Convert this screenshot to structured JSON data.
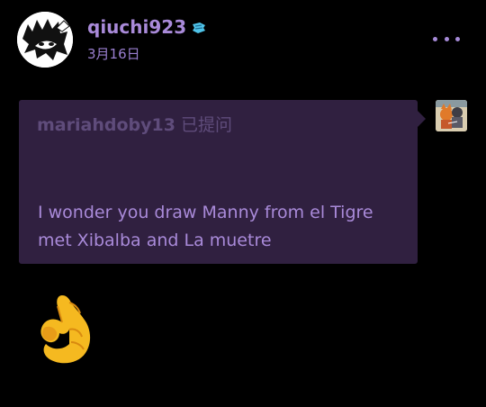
{
  "post": {
    "username": "qiuchi923",
    "badge_icon": "blue-badge-icon",
    "date": "3月16日",
    "more_icon": "ellipsis-icon"
  },
  "ask": {
    "asker": "mariahdoby13",
    "asked_label": "已提问",
    "question": "I wonder you draw Manny from el Tigre met Xibalba and La muetre"
  },
  "reply": {
    "emoji": "ok-hand-emoji"
  },
  "colors": {
    "background": "#000000",
    "username": "#a98ad9",
    "bubble": "#302040",
    "asker_text": "#5f4c7b",
    "question_text": "#a98ad9"
  }
}
